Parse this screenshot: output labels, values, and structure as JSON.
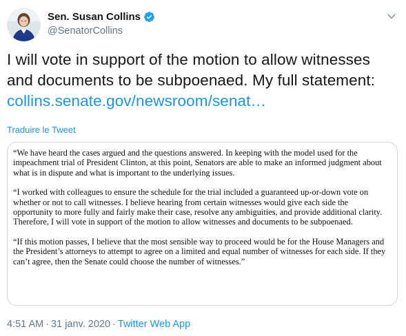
{
  "author": {
    "name": "Sen. Susan Collins",
    "handle": "@SenatorCollins",
    "verified_icon": "verified-badge-icon",
    "verified_color": "#1da1f2"
  },
  "menu_icon": "chevron-down-icon",
  "tweet": {
    "line1": "I will vote in support of the motion to allow witnesses",
    "line2": "and documents to be subpoenaed.  My full statement:",
    "link": "collins.senate.gov/newsroom/senat…"
  },
  "translate_label": "Traduire le Tweet",
  "statement": {
    "paragraphs": [
      "“We have heard the cases argued and the questions answered.  In keeping with the model used for the impeachment trial of President Clinton, at this point, Senators are able to make an informed judgment about what is in dispute and what is important to the underlying issues.",
      "“I worked with colleagues to ensure the schedule for the trial included a guaranteed up-or-down vote on whether or not to call witnesses.  I believe hearing from certain witnesses would give each side the opportunity to more fully and fairly make their case, resolve any ambiguities, and provide additional clarity. Therefore, I will vote in support of the motion to allow witnesses and documents to be subpoenaed.",
      "“If this motion passes, I believe that the most sensible way to proceed would be for the House Managers and the President’s attorneys to attempt to agree on a limited and equal number of witnesses for each side.  If they can’t agree, then the Senate could choose the number of witnesses.”"
    ]
  },
  "meta": {
    "time": "4:51 AM",
    "separator": "·",
    "date": "31 janv. 2020",
    "source": "Twitter Web App"
  },
  "colors": {
    "link": "#1b95e0",
    "secondary_text": "#657786",
    "primary_text": "#14171a",
    "border": "#ccd6dd"
  }
}
